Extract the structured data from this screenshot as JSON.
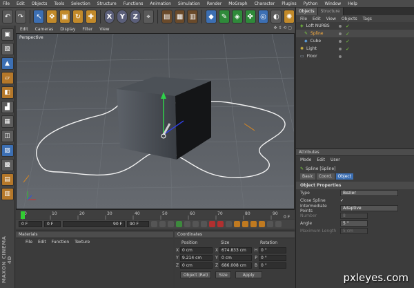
{
  "menubar": [
    "File",
    "Edit",
    "Objects",
    "Tools",
    "Selection",
    "Structure",
    "Functions",
    "Animation",
    "Simulation",
    "Render",
    "MoGraph",
    "Character",
    "Plugins",
    "Python",
    "Window",
    "Help"
  ],
  "viewport": {
    "menu": [
      "Edit",
      "Cameras",
      "Display",
      "Filter",
      "View"
    ],
    "label": "Perspective"
  },
  "timeline": {
    "ticks": [
      "0",
      "10",
      "20",
      "30",
      "40",
      "50",
      "60",
      "70",
      "80",
      "90"
    ],
    "frame_end_label": "0 F",
    "start_field": "0 F",
    "range_start": "0 F",
    "range_end": "90 F",
    "end_field": "90 F"
  },
  "materials": {
    "title": "Materials",
    "menu": [
      "File",
      "Edit",
      "Function",
      "Texture"
    ]
  },
  "coordinates": {
    "title": "Coordinates",
    "headers": [
      "Position",
      "Size",
      "Rotation"
    ],
    "rows": [
      {
        "axis": "X",
        "pos": "0 cm",
        "size_axis": "X",
        "size": "674.833 cm",
        "rot_axis": "H",
        "rot": "0 °"
      },
      {
        "axis": "Y",
        "pos": "9.214 cm",
        "size_axis": "Y",
        "size": "0 cm",
        "rot_axis": "P",
        "rot": "0 °"
      },
      {
        "axis": "Z",
        "pos": "0 cm",
        "size_axis": "Z",
        "size": "686.008 cm",
        "rot_axis": "B",
        "rot": "0 °"
      }
    ],
    "mode": "Object (Rel)",
    "size_mode": "Size",
    "apply": "Apply"
  },
  "objects": {
    "tabs": [
      "Objects",
      "Structure"
    ],
    "menu": [
      "File",
      "Edit",
      "View",
      "Objects",
      "Tags"
    ],
    "items": [
      {
        "name": "Loft NURBS",
        "color": "#c8c8c8",
        "selected": false
      },
      {
        "name": "Spline",
        "color": "#ffb040",
        "selected": true
      },
      {
        "name": "Cube",
        "color": "#c8c8c8",
        "selected": false
      },
      {
        "name": "Light",
        "color": "#c8c8c8",
        "selected": false
      },
      {
        "name": "Floor",
        "color": "#c8c8c8",
        "selected": false
      }
    ]
  },
  "attributes": {
    "title": "Attributes",
    "menu": [
      "Mode",
      "Edit",
      "User"
    ],
    "object": "Spline [Spline]",
    "tabs": [
      "Basic",
      "Coord.",
      "Object"
    ],
    "section": "Object Properties",
    "props": [
      {
        "label": "Type",
        "value": "Bezier",
        "dim": false
      },
      {
        "label": "Close Spline",
        "value": "✓",
        "dim": false
      },
      {
        "label": "Intermediate Points",
        "value": "Adaptive",
        "dim": false
      },
      {
        "label": "Number",
        "value": "8",
        "dim": true
      },
      {
        "label": "Angle",
        "value": "5 °",
        "dim": false
      },
      {
        "label": "Maximum Length",
        "value": "5 cm",
        "dim": true
      }
    ]
  },
  "side_logo": "MAXON CINEMA 4D",
  "watermark": "pxleyes.com"
}
